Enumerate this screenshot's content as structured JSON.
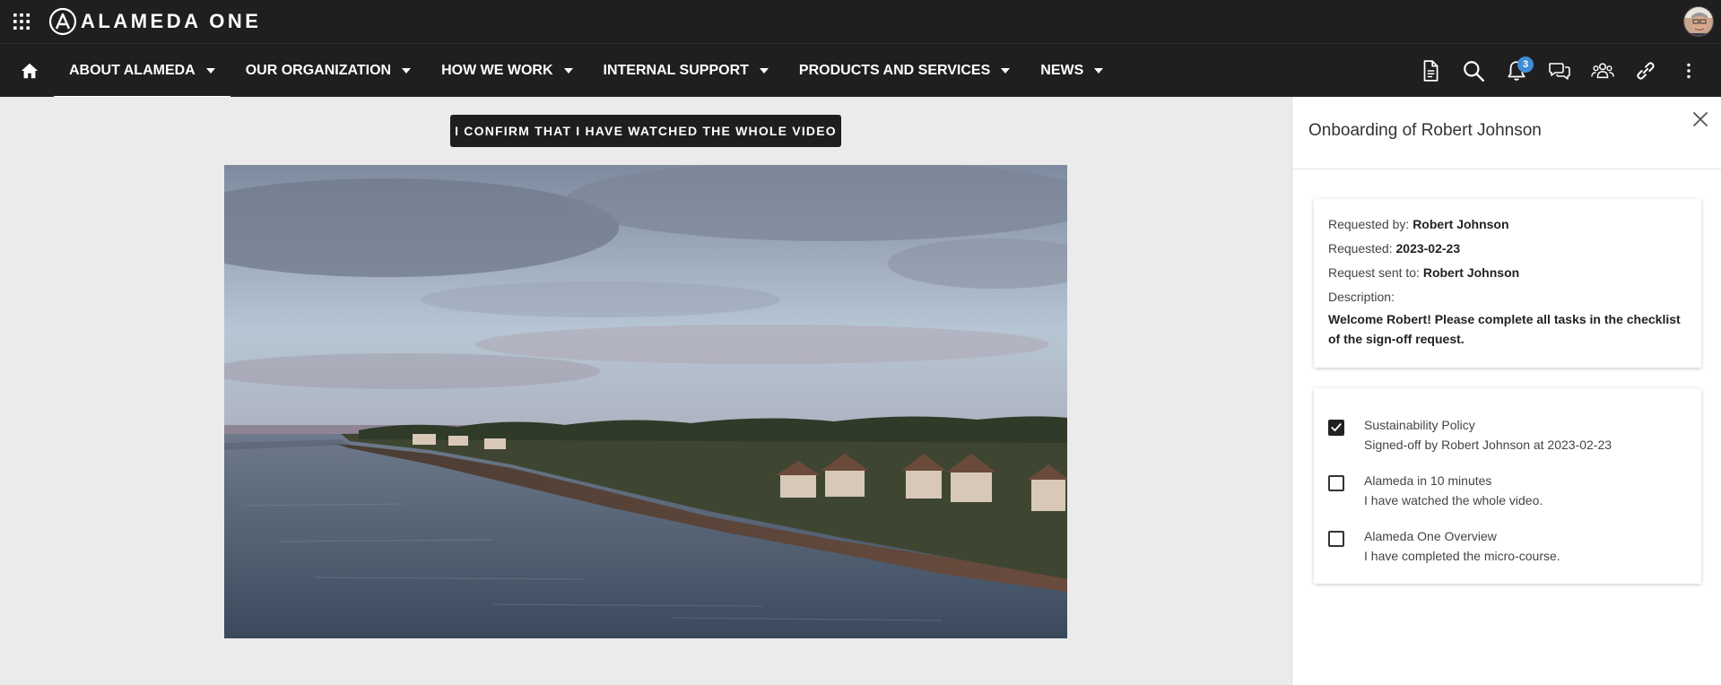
{
  "header": {
    "logo_text": "ALAMEDA ONE",
    "apps_icon": "apps-grid-icon",
    "avatar_icon": "user-avatar"
  },
  "nav": {
    "home_icon": "home-icon",
    "items": [
      {
        "label": "ABOUT ALAMEDA",
        "active": true
      },
      {
        "label": "OUR ORGANIZATION",
        "active": false
      },
      {
        "label": "HOW WE WORK",
        "active": false
      },
      {
        "label": "INTERNAL SUPPORT",
        "active": false
      },
      {
        "label": "PRODUCTS AND SERVICES",
        "active": false
      },
      {
        "label": "NEWS",
        "active": false
      }
    ],
    "icons": [
      "document-icon",
      "search-icon",
      "bell-icon",
      "chat-icon",
      "people-icon",
      "link-icon",
      "more-vert-icon"
    ],
    "notification_count": "3"
  },
  "main": {
    "confirm_button": "I CONFIRM THAT I HAVE WATCHED THE WHOLE VIDEO",
    "video": "coastline-video"
  },
  "panel": {
    "title": "Onboarding of Robert Johnson",
    "close_icon": "close-icon",
    "requested_by_label": "Requested by:",
    "requested_by": "Robert Johnson",
    "requested_label": "Requested:",
    "requested": "2023-02-23",
    "sent_to_label": "Request sent to:",
    "sent_to": "Robert Johnson",
    "description_label": "Description:",
    "description": "Welcome Robert! Please complete all tasks in the checklist of the sign-off request.",
    "tasks": [
      {
        "title": "Sustainability Policy",
        "subtitle": "Signed-off by Robert Johnson at 2023-02-23",
        "checked": true
      },
      {
        "title": "Alameda in 10 minutes",
        "subtitle": "I have watched the whole video.",
        "checked": false
      },
      {
        "title": "Alameda One Overview",
        "subtitle": "I have completed the micro-course.",
        "checked": false
      }
    ]
  },
  "colors": {
    "topbar": "#1f1f1f",
    "badge": "#3d8ed6",
    "background": "#ebebeb"
  }
}
